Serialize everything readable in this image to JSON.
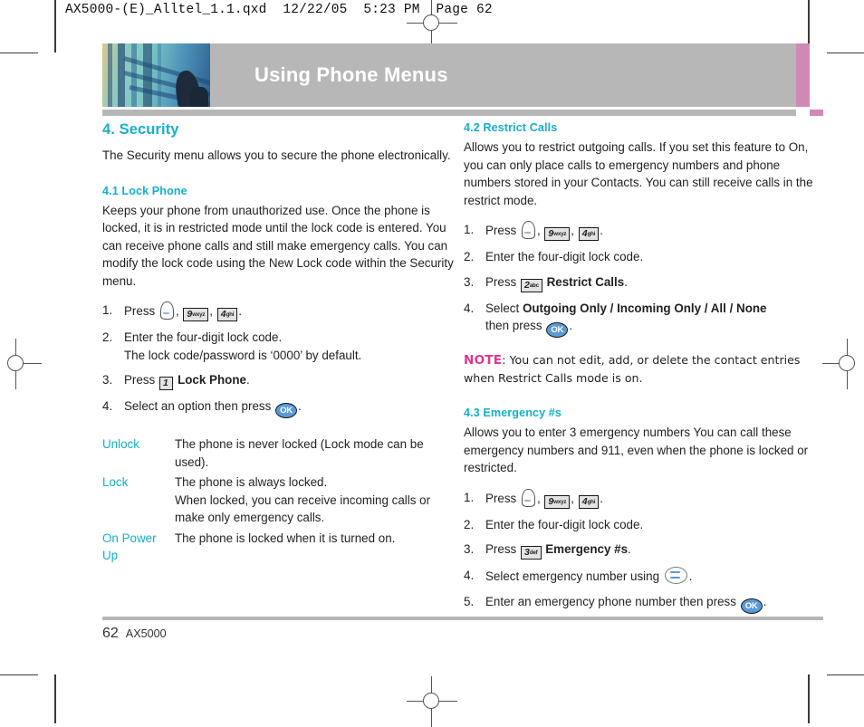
{
  "slug": "AX5000-(E)_Alltel_1.1.qxd  12/22/05  5:23 PM  Page 62",
  "banner": {
    "title": "Using Phone Menus",
    "accent_color": "#d189b4",
    "bar_color": "#b7b7b7"
  },
  "colors": {
    "heading": "#14b0c9",
    "note": "#e0368b",
    "ok_key": "#5b9bd5"
  },
  "left_column": {
    "section": {
      "title": "4. Security",
      "intro": "The Security menu allows you to secure the phone electronically."
    },
    "lock_phone": {
      "title": "4.1 Lock Phone",
      "body": "Keeps your phone from unauthorized use. Once the phone is locked, it is in restricted mode until the lock code is entered. You can receive phone calls and still make emergency calls. You can modify the lock code using the New Lock code within the Security menu.",
      "steps": [
        {
          "num": "1.",
          "pre": "Press",
          "post": ".",
          "keys": [
            "soft-key",
            "9wxyz",
            "4ghi"
          ]
        },
        {
          "num": "2.",
          "line1": "Enter the four-digit lock code.",
          "line2": "The lock code/password is ‘0000’ by default."
        },
        {
          "num": "3.",
          "pre": "Press",
          "key": "1",
          "bold": "Lock Phone",
          "post": "."
        },
        {
          "num": "4.",
          "pre": "Select an option then press",
          "key": "OK",
          "post": "."
        }
      ],
      "options": [
        {
          "term": "Unlock",
          "desc": "The phone is never locked (Lock mode can be used)."
        },
        {
          "term": "Lock",
          "desc_line1": "The phone is always locked.",
          "desc_line2": "When locked, you can receive incoming calls or make only emergency calls."
        },
        {
          "term": "On Power Up",
          "desc": "The phone is locked when it is turned on."
        }
      ]
    }
  },
  "right_column": {
    "restrict_calls": {
      "title": "4.2 Restrict Calls",
      "body": "Allows you to restrict outgoing calls. If you set this feature to On, you can only place calls to emergency numbers and phone numbers stored in your Contacts. You can still receive calls in the restrict mode.",
      "steps": [
        {
          "num": "1.",
          "pre": "Press",
          "post": ".",
          "keys": [
            "soft-key",
            "9wxyz",
            "4ghi"
          ]
        },
        {
          "num": "2.",
          "text": "Enter the four-digit lock code."
        },
        {
          "num": "3.",
          "pre": "Press",
          "key": "2",
          "bold": "Restrict Calls",
          "post": "."
        },
        {
          "num": "4.",
          "pre": "Select",
          "bold": "Outgoing Only / Incoming Only / All / None",
          "line2_pre": "then press",
          "key": "OK",
          "post": "."
        }
      ],
      "note_label": "NOTE",
      "note_text": ": You can not edit, add, or delete the contact entries when Restrict Calls mode is on."
    },
    "emergency": {
      "title": "4.3 Emergency #s",
      "body": "Allows you to enter 3 emergency numbers You can call these emergency numbers and 911, even when the phone is locked or restricted.",
      "steps": [
        {
          "num": "1.",
          "pre": "Press",
          "post": ".",
          "keys": [
            "soft-key",
            "9wxyz",
            "4ghi"
          ]
        },
        {
          "num": "2.",
          "text": "Enter the four-digit lock code."
        },
        {
          "num": "3.",
          "pre": "Press",
          "key": "3",
          "bold": "Emergency #s",
          "post": "."
        },
        {
          "num": "4.",
          "pre": "Select emergency number using",
          "key": "nav",
          "post": "."
        },
        {
          "num": "5.",
          "pre": "Enter an emergency phone number then press",
          "key": "OK",
          "post": "."
        }
      ]
    }
  },
  "keys": {
    "k9": {
      "digit": "9",
      "letters": "wxyz"
    },
    "k4": {
      "digit": "4",
      "letters": "ghi"
    },
    "k1": {
      "digit": "1",
      "letters": ""
    },
    "k2": {
      "digit": "2",
      "letters": "abc"
    },
    "k3": {
      "digit": "3",
      "letters": "def"
    },
    "ok": "OK"
  },
  "footer": {
    "page_number": "62",
    "model": "AX5000"
  }
}
